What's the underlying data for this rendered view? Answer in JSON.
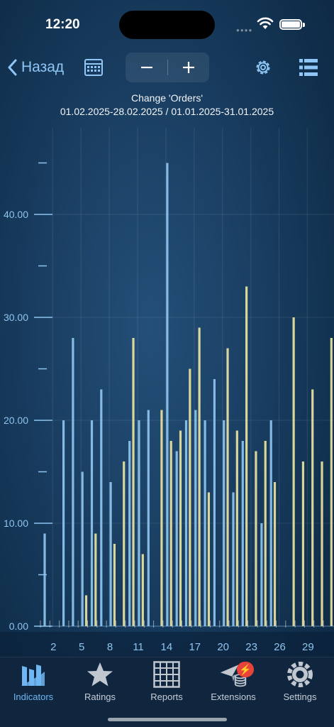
{
  "status": {
    "time": "12:20"
  },
  "toolbar": {
    "back_label": "Назад"
  },
  "chart_title": {
    "line1": "Change 'Orders'",
    "line2": "01.02.2025-28.02.2025 / 01.01.2025-31.01.2025"
  },
  "colors": {
    "blue_bar": "#8ec4ef",
    "yellow_bar": "#e9e3a0",
    "accent": "#6fb6f2",
    "badge": "#e8433a"
  },
  "chart_data": {
    "type": "bar",
    "ylim": [
      0,
      50
    ],
    "yticks": [
      "0.00",
      "10.00",
      "20.00",
      "30.00",
      "40.00"
    ],
    "xticks": [
      "2",
      "5",
      "8",
      "11",
      "14",
      "17",
      "20",
      "23",
      "26",
      "29"
    ],
    "series": [
      {
        "values": [
          9,
          20,
          28,
          15,
          20,
          23,
          14,
          18,
          20,
          21,
          45,
          17,
          20,
          21,
          20,
          24,
          20,
          13,
          18,
          10,
          20
        ]
      },
      {
        "values": [
          3,
          9,
          8,
          16,
          28,
          7,
          21,
          18,
          19,
          25,
          29,
          13,
          27,
          19,
          33,
          17,
          18,
          14,
          30,
          16,
          23,
          16,
          28
        ]
      }
    ]
  },
  "tabbar": {
    "tabs": [
      {
        "label": "Indicators",
        "icon": "indicators-icon"
      },
      {
        "label": "Ratings",
        "icon": "star-icon"
      },
      {
        "label": "Reports",
        "icon": "grid-icon"
      },
      {
        "label": "Extensions",
        "icon": "extensions-icon",
        "badge": "⚡"
      },
      {
        "label": "Settings",
        "icon": "gear-icon"
      }
    ]
  }
}
